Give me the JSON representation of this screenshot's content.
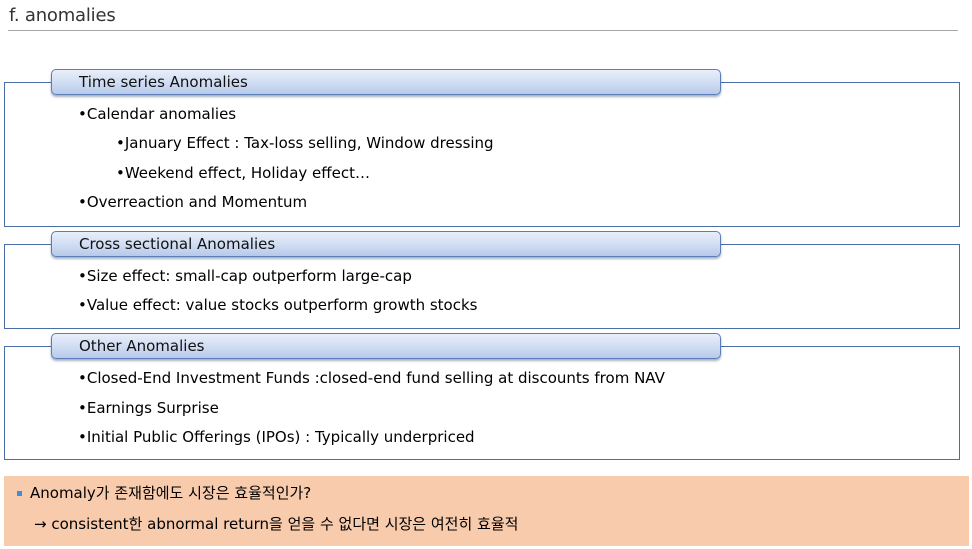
{
  "page": {
    "title": "f. anomalies"
  },
  "sections": [
    {
      "header": "Time series Anomalies",
      "items": [
        {
          "level": 1,
          "text": "•Calendar anomalies"
        },
        {
          "level": 2,
          "text": "•January Effect : Tax-loss selling, Window dressing"
        },
        {
          "level": 2,
          "text": "•Weekend effect, Holiday effect…"
        },
        {
          "level": 1,
          "text": "•Overreaction and Momentum"
        }
      ]
    },
    {
      "header": "Cross sectional Anomalies",
      "items": [
        {
          "level": 1,
          "text": "•Size effect: small-cap outperform large-cap"
        },
        {
          "level": 1,
          "text": "•Value effect:  value stocks outperform growth stocks"
        }
      ]
    },
    {
      "header": "Other Anomalies",
      "items": [
        {
          "level": 1,
          "text": "•Closed-End Investment Funds  :closed-end fund selling at discounts from NAV"
        },
        {
          "level": 1,
          "text": "•Earnings Surprise"
        },
        {
          "level": 1,
          "text": "•Initial Public Offerings (IPOs) : Typically underpriced"
        }
      ]
    }
  ],
  "conclusion": {
    "question": "Anomaly가 존재함에도 시장은 효율적인가?",
    "answer": "→ consistent한 abnormal return을 얻을 수 없다면 시장은 여전히 효율적"
  },
  "colors": {
    "box_border": "#4a6fa5",
    "tab_fill": "#cfdcf2",
    "conclusion_fill": "#f8cbad",
    "square_bullet": "#3e8ede"
  }
}
